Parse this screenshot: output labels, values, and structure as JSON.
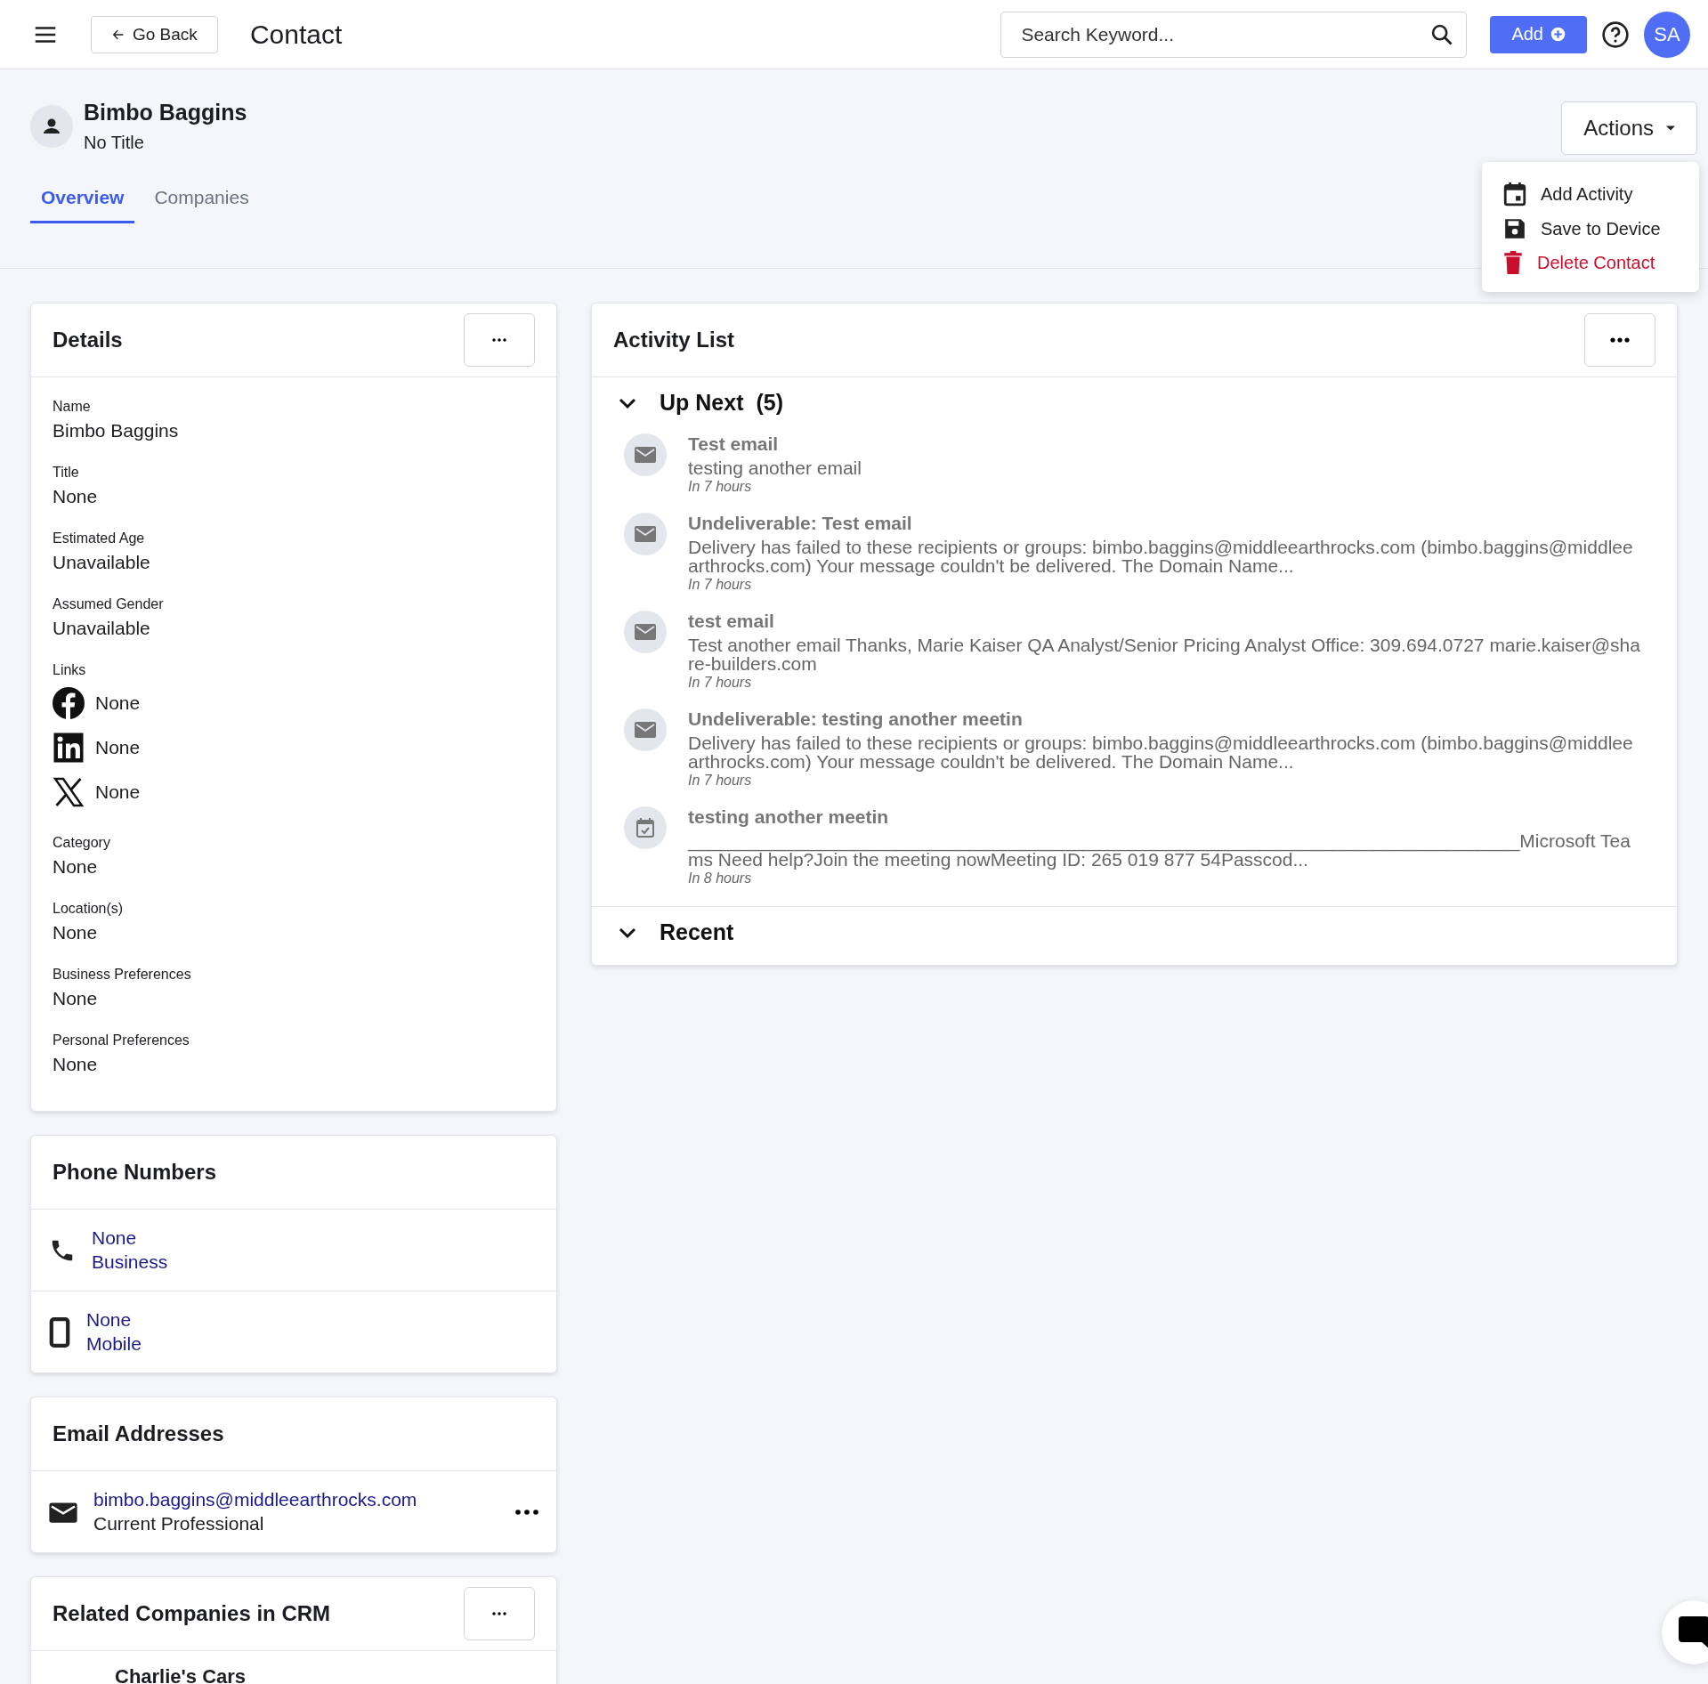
{
  "topbar": {
    "back_label": "Go Back",
    "title": "Contact",
    "search": {
      "placeholder": "Search Keyword..."
    },
    "add_label": "Add",
    "avatar": "SA"
  },
  "contact": {
    "name": "Bimbo Baggins",
    "subtitle": "No Title"
  },
  "tabs": [
    {
      "label": "Overview",
      "selected": true
    },
    {
      "label": "Companies",
      "selected": false
    }
  ],
  "actions": {
    "label": "Actions",
    "menu": [
      {
        "label": "Add Activity",
        "kind": "calendar"
      },
      {
        "label": "Save to Device",
        "kind": "save"
      },
      {
        "label": "Delete Contact",
        "kind": "delete"
      }
    ]
  },
  "details": {
    "title": "Details",
    "fields": [
      {
        "kind": "text",
        "label": "Name",
        "value": "Bimbo Baggins"
      },
      {
        "kind": "text",
        "label": "Title",
        "value": "None"
      },
      {
        "kind": "text",
        "label": "Estimated Age",
        "value": "Unavailable"
      },
      {
        "kind": "text",
        "label": "Assumed Gender",
        "value": "Unavailable"
      },
      {
        "kind": "links",
        "label": "Links",
        "links": [
          {
            "kind": "facebook",
            "value": "None"
          },
          {
            "kind": "linkedin",
            "value": "None"
          },
          {
            "kind": "x",
            "value": "None"
          }
        ]
      },
      {
        "kind": "text",
        "label": "Category",
        "value": "None"
      },
      {
        "kind": "text",
        "label": "Location(s)",
        "value": "None"
      },
      {
        "kind": "text",
        "label": "Business Preferences",
        "value": "None"
      },
      {
        "kind": "text",
        "label": "Personal Preferences",
        "value": "None"
      }
    ]
  },
  "phone_numbers": {
    "title": "Phone Numbers",
    "items": [
      {
        "kind": "phone",
        "number": "None",
        "type": "Business"
      },
      {
        "kind": "mobile",
        "number": "None",
        "type": "Mobile"
      }
    ]
  },
  "email_addresses": {
    "title": "Email Addresses",
    "items": [
      {
        "address": "bimbo.baggins@middleearthrocks.com",
        "type": "Current Professional"
      }
    ]
  },
  "related_companies": {
    "title": "Related Companies in CRM",
    "items": [
      "Charlie's Cars"
    ]
  },
  "activity_list": {
    "title": "Activity List",
    "sections": [
      {
        "title": "Up Next",
        "count": "(5)",
        "items": [
          {
            "kind": "email",
            "title": "Test email",
            "body": "testing another email",
            "time": "In 7 hours"
          },
          {
            "kind": "email",
            "title": "Undeliverable: Test email",
            "body": "Delivery has failed to these recipients or groups: bimbo.baggins@middleearthrocks.com (bimbo.baggins@middleearthrocks.com) Your message couldn't be delivered. The Domain Name...",
            "time": "In 7 hours"
          },
          {
            "kind": "email",
            "title": "test email",
            "body": "Test another email   Thanks,   Marie Kaiser QA Analyst/Senior Pricing Analyst Office: 309.694.0727 marie.kaiser@share-builders.com",
            "time": "In 7 hours"
          },
          {
            "kind": "email",
            "title": "Undeliverable: testing another meetin",
            "body": "Delivery has failed to these recipients or groups: bimbo.baggins@middleearthrocks.com (bimbo.baggins@middleearthrocks.com) Your message couldn't be delivered. The Domain Name...",
            "time": "In 7 hours"
          },
          {
            "kind": "meeting",
            "title": "testing another meetin",
            "body": "________________________________________________________________________________Microsoft Teams Need help?Join the meeting nowMeeting ID: 265 019 877 54Passcod...",
            "time": "In 8 hours"
          }
        ]
      },
      {
        "title": "Recent"
      }
    ]
  }
}
